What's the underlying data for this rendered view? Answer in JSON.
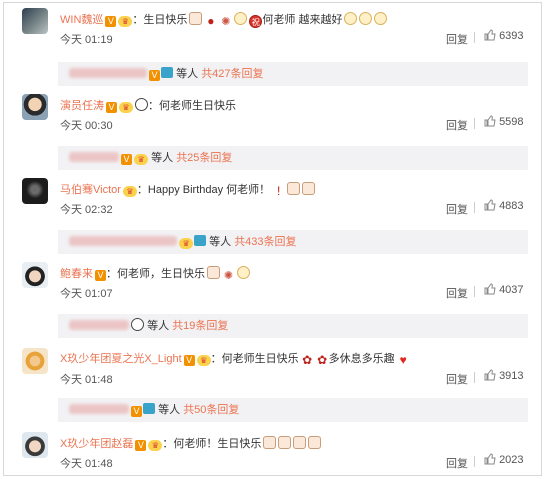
{
  "comments": [
    {
      "user": "WIN魏巡",
      "sep": "：",
      "text_before": "生日快乐",
      "emoji_a": [
        "cake",
        "balloon",
        "party",
        "smile",
        "red"
      ],
      "text_mid": "何老师 越来越好",
      "emoji_b": [
        "smile",
        "smile",
        "smile"
      ],
      "time": "今天 01:19",
      "reply": "回复",
      "likes": "6393",
      "sub": {
        "suffix": "等人",
        "count": "共427条回复"
      }
    },
    {
      "user": "演员任涛",
      "sep": "：",
      "text_before": "何老师生日快乐",
      "time": "今天 00:30",
      "reply": "回复",
      "likes": "5598",
      "sub": {
        "suffix": "等人",
        "count": "共25条回复"
      }
    },
    {
      "user": "马伯骞Victor",
      "sep": "：",
      "text_before": "Happy Birthday 何老师！",
      "time": "今天 02:32",
      "reply": "回复",
      "likes": "4883",
      "sub": {
        "suffix": "等人",
        "count": "共433条回复"
      }
    },
    {
      "user": "鲍春来",
      "sep": "：",
      "text_before": "何老师，生日快乐",
      "time": "今天 01:07",
      "reply": "回复",
      "likes": "4037",
      "sub": {
        "suffix": "等人",
        "count": "共19条回复"
      }
    },
    {
      "user": "X玖少年团夏之光X_Light",
      "sep": "：",
      "text_before": "何老师生日快乐",
      "text_mid": "多休息多乐趣",
      "time": "今天 01:48",
      "reply": "回复",
      "likes": "3913",
      "sub": {
        "suffix": "等人",
        "count": "共50条回复"
      }
    },
    {
      "user": "X玖少年团赵磊",
      "sep": "：",
      "text_before": "何老师！生日快乐",
      "time": "今天 01:48",
      "reply": "回复",
      "likes": "2023"
    }
  ],
  "icons": {
    "verified": "V",
    "level": "V",
    "thumb": "thumb-up-icon"
  },
  "colors": {
    "username": "#eb7350",
    "reply_count": "#eb7350",
    "subbox_bg": "#f2f2f5"
  }
}
